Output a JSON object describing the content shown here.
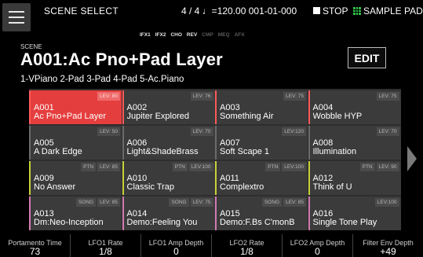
{
  "topbar": {
    "title": "SCENE SELECT",
    "status": "4 / 4  ♩=120.00   001-01-000",
    "stop_label": "STOP",
    "pad_label": "SAMPLE PAD"
  },
  "effects": [
    {
      "label": "IFX1",
      "on": true
    },
    {
      "label": "IFX2",
      "on": true
    },
    {
      "label": "CHO",
      "on": true
    },
    {
      "label": "REV",
      "on": true
    },
    {
      "label": "CMP",
      "on": false
    },
    {
      "label": "MEQ",
      "on": false
    },
    {
      "label": "AFX",
      "on": false
    }
  ],
  "scene": {
    "label": "SCENE",
    "title": "A001:Ac Pno+Pad Layer",
    "parts": "1-VPiano 2-Pad 3-Pad 4-Pad 5-Ac.Piano",
    "edit_label": "EDIT"
  },
  "scenes": [
    {
      "num": "A001",
      "name": "Ac Pno+Pad Layer",
      "ptn": "",
      "song": "",
      "lev": "LEV: 80",
      "selected": true
    },
    {
      "num": "A002",
      "name": "Jupiter Explored",
      "ptn": "",
      "song": "",
      "lev": "LEV: 76"
    },
    {
      "num": "A003",
      "name": "Something Air",
      "ptn": "",
      "song": "",
      "lev": "LEV: 75"
    },
    {
      "num": "A004",
      "name": "Wobble HYP",
      "ptn": "",
      "song": "",
      "lev": "LEV: 75"
    },
    {
      "num": "A005",
      "name": "A Dark Edge",
      "ptn": "",
      "song": "",
      "lev": "LEV: 50"
    },
    {
      "num": "A006",
      "name": "Light&ShadeBrass",
      "ptn": "",
      "song": "",
      "lev": "LEV: 70"
    },
    {
      "num": "A007",
      "name": "Soft Scape 1",
      "ptn": "",
      "song": "",
      "lev": "LEV:120"
    },
    {
      "num": "A008",
      "name": "Illumination",
      "ptn": "",
      "song": "",
      "lev": "LEV: 70"
    },
    {
      "num": "A009",
      "name": "No Answer",
      "ptn": "PTN",
      "song": "",
      "lev": "LEV: 85"
    },
    {
      "num": "A010",
      "name": "Classic Trap",
      "ptn": "PTN",
      "song": "",
      "lev": "LEV:100"
    },
    {
      "num": "A011",
      "name": "Complextro",
      "ptn": "PTN",
      "song": "",
      "lev": "LEV:100"
    },
    {
      "num": "A012",
      "name": "Think of U",
      "ptn": "PTN",
      "song": "",
      "lev": "LEV: 90"
    },
    {
      "num": "A013",
      "name": "Dm:Neo-Inception",
      "ptn": "",
      "song": "SONG",
      "lev": "LEV: 85"
    },
    {
      "num": "A014",
      "name": "Demo:Feeling You",
      "ptn": "",
      "song": "SONG",
      "lev": "LEV: 75"
    },
    {
      "num": "A015",
      "name": "Demo:F.Bs C'monB",
      "ptn": "",
      "song": "SONG",
      "lev": "LEV: 85"
    },
    {
      "num": "A016",
      "name": "Single Tone Play",
      "ptn": "",
      "song": "",
      "lev": "LEV:100"
    }
  ],
  "params": [
    {
      "label": "Portamento Time",
      "value": "73"
    },
    {
      "label": "LFO1 Rate",
      "value": "1/8"
    },
    {
      "label": "LFO1 Amp Depth",
      "value": "0"
    },
    {
      "label": "LFO2 Rate",
      "value": "1/8"
    },
    {
      "label": "LFO2 Amp Depth",
      "value": "0"
    },
    {
      "label": "Filter Env Depth",
      "value": "+49"
    }
  ],
  "colors": {
    "selected": "#e53e3e",
    "pad_icon": "#2ec14a",
    "row1_stripe": "#ff5a5a",
    "row2_stripe": "#6b6b6b",
    "row3_stripe": "#c7d238",
    "row4_stripe": "#d27ab4"
  }
}
